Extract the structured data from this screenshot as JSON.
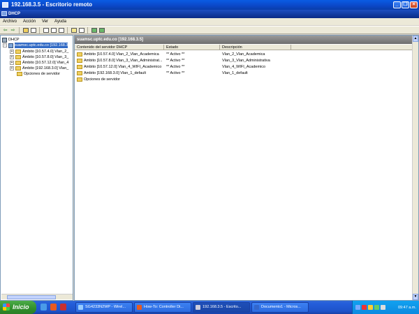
{
  "rdp_window": {
    "title": "192.168.3.5 - Escritorio remoto"
  },
  "mmc_window": {
    "title": "DHCP"
  },
  "menu": [
    "Archivo",
    "Acción",
    "Ver",
    "Ayuda"
  ],
  "tree": {
    "root": "DHCP",
    "server": "suamsc.uptc.edu.co [192.168.3",
    "items": [
      "Ámbito [10.57.4.0] Vlan_2_",
      "Ámbito [10.57.8.0] Vlan_3_",
      "Ámbito [10.57.12.0] Vlan_4",
      "Ámbito [192.168.3.0] Vlan_",
      "Opciones de servidor"
    ]
  },
  "right_pane": {
    "header": "suamsc.uptc.edu.co [192.168.3.5]",
    "columns": [
      "Contenido del servidor DHCP",
      "Estado",
      "Descripción"
    ],
    "rows": [
      {
        "name": "Ámbito [10.57.4.0] Vlan_2_Vlan_Academica",
        "status": "** Activo **",
        "description": "Vlan_2_Vlan_Academica"
      },
      {
        "name": "Ámbito [10.57.8.0] Vlan_3_Vlan_Administrat...",
        "status": "** Activo **",
        "description": "Vlan_3_Vlan_Administrativa"
      },
      {
        "name": "Ámbito [10.57.12.0] Vlan_4_WIFI_Academico",
        "status": "** Activo **",
        "description": "Vlan_4_WIFI_Academico"
      },
      {
        "name": "Ámbito [192.168.3.0] Vlan_1_default",
        "status": "** Activo **",
        "description": "Vlan_1_default"
      },
      {
        "name": "Opciones de servidor",
        "status": "",
        "description": ""
      }
    ]
  },
  "taskbar": {
    "start_label": "Inicio",
    "tasks": [
      "SG4233N2WP - Wirel...",
      "How-To: Controller Di...",
      "192.168.3.5 - Escrito...",
      "Documento1 - Micros..."
    ],
    "clock": "09:47 a.m."
  }
}
